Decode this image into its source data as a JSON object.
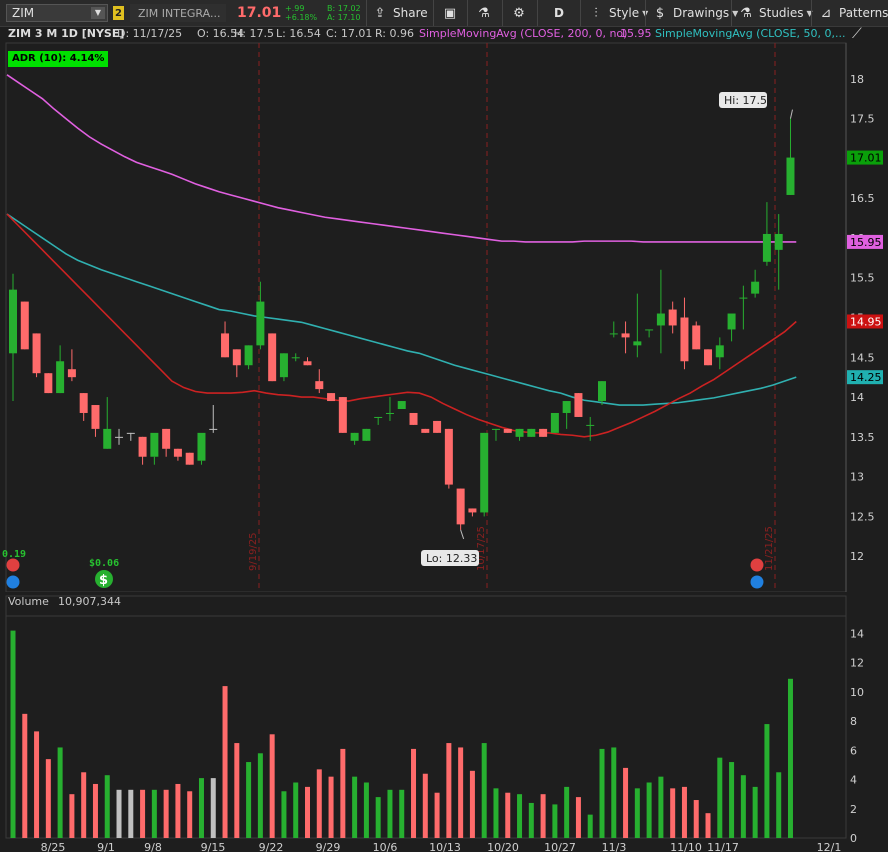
{
  "toolbar": {
    "symbol": "ZIM",
    "badge": "2",
    "company": "ZIM INTEGRA...",
    "last_price": "17.01",
    "change": "+.99",
    "change_pct": "+6.18%",
    "bid": "B: 17.02",
    "ask": "A: 17.10",
    "share_label": "Share",
    "period_label": "D",
    "style_label": "Style",
    "drawings_label": "Drawings",
    "studies_label": "Studies",
    "patterns_label": "Patterns"
  },
  "header": {
    "title": "ZIM 3 M 1D [NYSE]",
    "date": "D: 11/17/25",
    "open": "O: 16.54",
    "high": "H: 17.5",
    "low": "L: 16.54",
    "close": "C: 17.01",
    "range": "R: 0.96",
    "sma200_label": "SimpleMovingAvg (CLOSE, 200, 0, no)",
    "sma200_value": "15.95",
    "sma50_label": "SimpleMovingAvg (CLOSE, 50, 0,..."
  },
  "adr_badge": "ADR (10): 4.14%",
  "price_labels": {
    "last": "17.01",
    "sma200": "15.95",
    "sma50_red": "14.95",
    "sma_teal": "14.25"
  },
  "callouts": {
    "hi": "Hi: 17.5",
    "lo": "Lo: 12.33"
  },
  "events": {
    "div_left": "0.19",
    "div_mid": "$0.06"
  },
  "vertical_markers": [
    "9/19/25",
    "10/17/25",
    "11/21/25"
  ],
  "volume": {
    "label": "Volume",
    "value": "10,907,344"
  },
  "colors": {
    "up": "#27b030",
    "down": "#ff6b6b",
    "neutral": "#c0c0c0",
    "sma200": "#e060e0",
    "sma50": "#30b0b0",
    "sma_red": "#cc2222",
    "bg": "#1e1e1e",
    "last_badge": "#0aa00a",
    "adr_badge": "#00e000"
  },
  "chart_data": {
    "type": "candlestick",
    "x_ticks": [
      "8/25",
      "9/1",
      "9/8",
      "9/15",
      "9/22",
      "9/29",
      "10/6",
      "10/13",
      "10/20",
      "10/27",
      "11/3",
      "11/10",
      "11/17",
      "12/1"
    ],
    "y_ticks": [
      12,
      12.5,
      13,
      13.5,
      14,
      14.5,
      15,
      15.5,
      16,
      16.5,
      17,
      17.5,
      18
    ],
    "ylim": [
      11.55,
      18.45
    ],
    "volume_ticks": [
      0,
      2,
      4,
      6,
      8,
      10,
      12,
      14
    ],
    "volume_ylim": [
      0,
      15.2
    ],
    "candles": [
      {
        "o": 14.55,
        "h": 15.55,
        "l": 13.95,
        "c": 15.35,
        "v": 14.2
      },
      {
        "o": 15.2,
        "h": 15.2,
        "l": 14.6,
        "c": 14.6,
        "v": 8.5
      },
      {
        "o": 14.8,
        "h": 14.8,
        "l": 14.25,
        "c": 14.3,
        "v": 7.3
      },
      {
        "o": 14.3,
        "h": 14.3,
        "l": 14.05,
        "c": 14.05,
        "v": 5.4
      },
      {
        "o": 14.05,
        "h": 14.65,
        "l": 14.05,
        "c": 14.45,
        "v": 6.2
      },
      {
        "o": 14.35,
        "h": 14.6,
        "l": 14.2,
        "c": 14.25,
        "v": 3
      },
      {
        "o": 14.05,
        "h": 14.05,
        "l": 13.7,
        "c": 13.8,
        "v": 4.5
      },
      {
        "o": 13.9,
        "h": 13.9,
        "l": 13.5,
        "c": 13.6,
        "v": 3.7
      },
      {
        "o": 13.35,
        "h": 14,
        "l": 13.35,
        "c": 13.6,
        "v": 4.3
      },
      {
        "o": 13.5,
        "h": 13.6,
        "l": 13.4,
        "c": 13.5,
        "v": 3.3,
        "n": 1
      },
      {
        "o": 13.55,
        "h": 13.55,
        "l": 13.45,
        "c": 13.55,
        "v": 3.3,
        "n": 1
      },
      {
        "o": 13.5,
        "h": 13.5,
        "l": 13.15,
        "c": 13.25,
        "v": 3.3
      },
      {
        "o": 13.25,
        "h": 13.25,
        "l": 13.15,
        "c": 13.55,
        "v": 3.3
      },
      {
        "o": 13.6,
        "h": 13.6,
        "l": 13.25,
        "c": 13.35,
        "v": 3.3
      },
      {
        "o": 13.35,
        "h": 13.35,
        "l": 13.2,
        "c": 13.25,
        "v": 3.7
      },
      {
        "o": 13.3,
        "h": 13.3,
        "l": 13.15,
        "c": 13.15,
        "v": 3.2
      },
      {
        "o": 13.2,
        "h": 13.2,
        "l": 13.15,
        "c": 13.55,
        "v": 4.1
      },
      {
        "o": 13.6,
        "h": 13.9,
        "l": 13.55,
        "c": 13.6,
        "v": 4.1,
        "n": 1
      },
      {
        "o": 14.8,
        "h": 14.95,
        "l": 14.5,
        "c": 14.5,
        "v": 10.4
      },
      {
        "o": 14.6,
        "h": 14.6,
        "l": 14.25,
        "c": 14.4,
        "v": 6.5
      },
      {
        "o": 14.4,
        "h": 14.65,
        "l": 14.35,
        "c": 14.65,
        "v": 5.2
      },
      {
        "o": 14.65,
        "h": 15.45,
        "l": 14.6,
        "c": 15.2,
        "v": 5.8
      },
      {
        "o": 14.8,
        "h": 14.8,
        "l": 14.2,
        "c": 14.2,
        "v": 7.1
      },
      {
        "o": 14.25,
        "h": 14.55,
        "l": 14.2,
        "c": 14.55,
        "v": 3.2
      },
      {
        "o": 14.5,
        "h": 14.55,
        "l": 14.45,
        "c": 14.5,
        "v": 3.8
      },
      {
        "o": 14.45,
        "h": 14.5,
        "l": 14.4,
        "c": 14.4,
        "v": 3.5
      },
      {
        "o": 14.2,
        "h": 14.35,
        "l": 14.05,
        "c": 14.1,
        "v": 4.7
      },
      {
        "o": 14.05,
        "h": 14.05,
        "l": 13.95,
        "c": 13.95,
        "v": 4.2
      },
      {
        "o": 14,
        "h": 14,
        "l": 13.55,
        "c": 13.55,
        "v": 6.1
      },
      {
        "o": 13.45,
        "h": 13.55,
        "l": 13.4,
        "c": 13.55,
        "v": 4.2
      },
      {
        "o": 13.45,
        "h": 13.6,
        "l": 13.45,
        "c": 13.6,
        "v": 3.8
      },
      {
        "o": 13.75,
        "h": 13.75,
        "l": 13.65,
        "c": 13.75,
        "v": 2.8
      },
      {
        "o": 13.8,
        "h": 14,
        "l": 13.7,
        "c": 13.8,
        "v": 3.3
      },
      {
        "o": 13.85,
        "h": 13.95,
        "l": 13.85,
        "c": 13.95,
        "v": 3.3
      },
      {
        "o": 13.8,
        "h": 13.8,
        "l": 13.65,
        "c": 13.65,
        "v": 6.1
      },
      {
        "o": 13.6,
        "h": 13.6,
        "l": 13.55,
        "c": 13.55,
        "v": 4.4
      },
      {
        "o": 13.7,
        "h": 13.7,
        "l": 13.55,
        "c": 13.55,
        "v": 3.1
      },
      {
        "o": 13.6,
        "h": 13.6,
        "l": 12.85,
        "c": 12.9,
        "v": 6.5
      },
      {
        "o": 12.85,
        "h": 12.85,
        "l": 12.33,
        "c": 12.4,
        "v": 6.2
      },
      {
        "o": 12.6,
        "h": 12.6,
        "l": 12.5,
        "c": 12.55,
        "v": 4.6
      },
      {
        "o": 12.55,
        "h": 13.55,
        "l": 12.5,
        "c": 13.55,
        "v": 6.5
      },
      {
        "o": 13.6,
        "h": 13.6,
        "l": 13.45,
        "c": 13.6,
        "v": 3.4
      },
      {
        "o": 13.6,
        "h": 13.6,
        "l": 13.55,
        "c": 13.55,
        "v": 3.1
      },
      {
        "o": 13.5,
        "h": 13.6,
        "l": 13.45,
        "c": 13.6,
        "v": 3
      },
      {
        "o": 13.5,
        "h": 13.6,
        "l": 13.5,
        "c": 13.6,
        "v": 2.4
      },
      {
        "o": 13.6,
        "h": 13.6,
        "l": 13.5,
        "c": 13.5,
        "v": 3
      },
      {
        "o": 13.55,
        "h": 13.8,
        "l": 13.55,
        "c": 13.8,
        "v": 2.3
      },
      {
        "o": 13.8,
        "h": 13.95,
        "l": 13.6,
        "c": 13.95,
        "v": 3.5
      },
      {
        "o": 14.05,
        "h": 14.05,
        "l": 13.75,
        "c": 13.75,
        "v": 2.8
      },
      {
        "o": 13.65,
        "h": 13.75,
        "l": 13.45,
        "c": 13.65,
        "v": 1.6
      },
      {
        "o": 13.95,
        "h": 14.2,
        "l": 13.9,
        "c": 14.2,
        "v": 6.1
      },
      {
        "o": 14.8,
        "h": 14.95,
        "l": 14.75,
        "c": 14.8,
        "v": 6.2
      },
      {
        "o": 14.8,
        "h": 14.95,
        "l": 14.55,
        "c": 14.75,
        "v": 4.8
      },
      {
        "o": 14.65,
        "h": 15.3,
        "l": 14.5,
        "c": 14.7,
        "v": 3.4
      },
      {
        "o": 14.85,
        "h": 14.85,
        "l": 14.75,
        "c": 14.85,
        "v": 3.8
      },
      {
        "o": 14.9,
        "h": 15.6,
        "l": 14.55,
        "c": 15.05,
        "v": 4.2
      },
      {
        "o": 15.1,
        "h": 15.2,
        "l": 14.8,
        "c": 14.9,
        "v": 3.4
      },
      {
        "o": 15.0,
        "h": 15.25,
        "l": 14.35,
        "c": 14.45,
        "v": 3.5
      },
      {
        "o": 14.9,
        "h": 14.95,
        "l": 14.6,
        "c": 14.6,
        "v": 2.6
      },
      {
        "o": 14.6,
        "h": 14.6,
        "l": 14.4,
        "c": 14.4,
        "v": 1.7
      },
      {
        "o": 14.5,
        "h": 14.75,
        "l": 14.35,
        "c": 14.65,
        "v": 5.5
      },
      {
        "o": 14.85,
        "h": 15.0,
        "l": 14.7,
        "c": 15.05,
        "v": 5.2
      },
      {
        "o": 15.25,
        "h": 15.4,
        "l": 14.85,
        "c": 15.25,
        "v": 4.3
      },
      {
        "o": 15.3,
        "h": 15.6,
        "l": 15.25,
        "c": 15.45,
        "v": 3.5
      },
      {
        "o": 15.7,
        "h": 16.45,
        "l": 15.65,
        "c": 16.05,
        "v": 7.8
      },
      {
        "o": 15.85,
        "h": 16.3,
        "l": 15.35,
        "c": 16.05,
        "v": 4.5
      },
      {
        "o": 16.54,
        "h": 17.5,
        "l": 16.54,
        "c": 17.01,
        "v": 10.9
      }
    ],
    "sma200": [
      18.05,
      17.95,
      17.85,
      17.75,
      17.62,
      17.5,
      17.38,
      17.27,
      17.18,
      17.1,
      17.02,
      16.95,
      16.9,
      16.85,
      16.8,
      16.74,
      16.68,
      16.63,
      16.58,
      16.54,
      16.5,
      16.46,
      16.42,
      16.38,
      16.35,
      16.32,
      16.29,
      16.26,
      16.24,
      16.22,
      16.2,
      16.18,
      16.16,
      16.14,
      16.12,
      16.1,
      16.08,
      16.06,
      16.04,
      16.02,
      16.0,
      15.98,
      15.96,
      15.96,
      15.95,
      15.95,
      15.95,
      15.95,
      15.95,
      15.96,
      15.96,
      15.96,
      15.96,
      15.96,
      15.95,
      15.95,
      15.95,
      15.95,
      15.95,
      15.95,
      15.95,
      15.95,
      15.95,
      15.95,
      15.95,
      15.95,
      15.95,
      15.95
    ],
    "sma50": [
      16.3,
      16.2,
      16.1,
      16.0,
      15.9,
      15.8,
      15.72,
      15.66,
      15.6,
      15.55,
      15.5,
      15.45,
      15.4,
      15.35,
      15.3,
      15.25,
      15.2,
      15.15,
      15.1,
      15.08,
      15.05,
      15.02,
      15.0,
      14.98,
      14.96,
      14.94,
      14.9,
      14.86,
      14.82,
      14.78,
      14.74,
      14.7,
      14.66,
      14.62,
      14.58,
      14.55,
      14.5,
      14.45,
      14.4,
      14.36,
      14.32,
      14.28,
      14.24,
      14.2,
      14.16,
      14.12,
      14.08,
      14.05,
      14.0,
      13.96,
      13.94,
      13.92,
      13.9,
      13.9,
      13.9,
      13.91,
      13.92,
      13.93,
      13.95,
      13.97,
      13.99,
      14.02,
      14.05,
      14.08,
      14.11,
      14.15,
      14.2,
      14.25
    ],
    "sma_red": [
      16.3,
      16.15,
      16.0,
      15.85,
      15.7,
      15.55,
      15.4,
      15.25,
      15.1,
      14.95,
      14.8,
      14.65,
      14.5,
      14.35,
      14.2,
      14.12,
      14.07,
      14.05,
      14.05,
      14.05,
      14.06,
      14.08,
      14.05,
      14.03,
      14.02,
      14.0,
      14.0,
      13.98,
      13.96,
      13.95,
      13.98,
      14.0,
      14.02,
      14.04,
      14.06,
      14.05,
      14.0,
      13.92,
      13.85,
      13.78,
      13.72,
      13.67,
      13.62,
      13.58,
      13.56,
      13.55,
      13.55,
      13.53,
      13.52,
      13.5,
      13.52,
      13.56,
      13.62,
      13.68,
      13.75,
      13.82,
      13.9,
      13.98,
      14.05,
      14.14,
      14.22,
      14.32,
      14.42,
      14.52,
      14.62,
      14.72,
      14.82,
      14.95
    ]
  }
}
